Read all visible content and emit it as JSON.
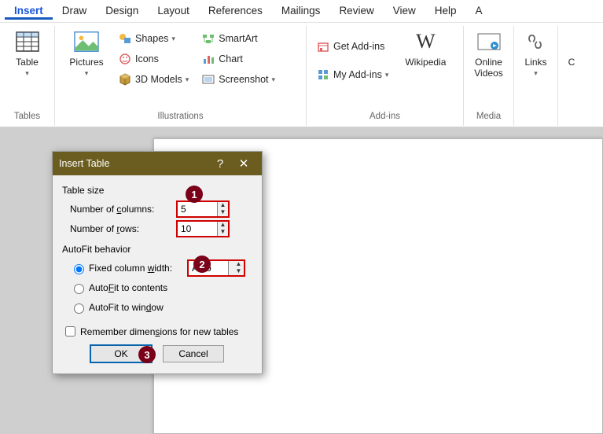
{
  "tabs": [
    "Insert",
    "Draw",
    "Design",
    "Layout",
    "References",
    "Mailings",
    "Review",
    "View",
    "Help",
    "A"
  ],
  "active_tab": 0,
  "groups": {
    "tables": {
      "table_btn": "Table",
      "label": "Tables"
    },
    "illustrations": {
      "pictures_btn": "Pictures",
      "shapes": "Shapes",
      "icons": "Icons",
      "models": "3D Models",
      "smartart": "SmartArt",
      "chart": "Chart",
      "screenshot": "Screenshot",
      "label": "Illustrations"
    },
    "addins": {
      "get": "Get Add-ins",
      "my": "My Add-ins",
      "wiki": "Wikipedia",
      "label": "Add-ins"
    },
    "media": {
      "btn": "Online Videos",
      "label": "Media"
    },
    "links": {
      "btn": "Links",
      "label": ""
    },
    "comments_initial": "C"
  },
  "dialog": {
    "title": "Insert Table",
    "table_size": "Table size",
    "cols_label_pre": "Number of ",
    "cols_label_u": "c",
    "cols_label_post": "olumns:",
    "cols_value": "5",
    "rows_label_pre": "Number of ",
    "rows_label_u": "r",
    "rows_label_post": "ows:",
    "rows_value": "10",
    "autofit": "AutoFit behavior",
    "fixed_pre": "Fixed column ",
    "fixed_u": "w",
    "fixed_post": "idth:",
    "fixed_value": "Auto",
    "fitcontents_pre": "Auto",
    "fitcontents_u": "F",
    "fitcontents_post": "it to contents",
    "fitwindow_pre": "AutoFit to win",
    "fitwindow_u": "d",
    "fitwindow_post": "ow",
    "remember_pre": "Remember dimen",
    "remember_u": "s",
    "remember_post": "ions for new tables",
    "ok": "OK",
    "cancel": "Cancel"
  }
}
